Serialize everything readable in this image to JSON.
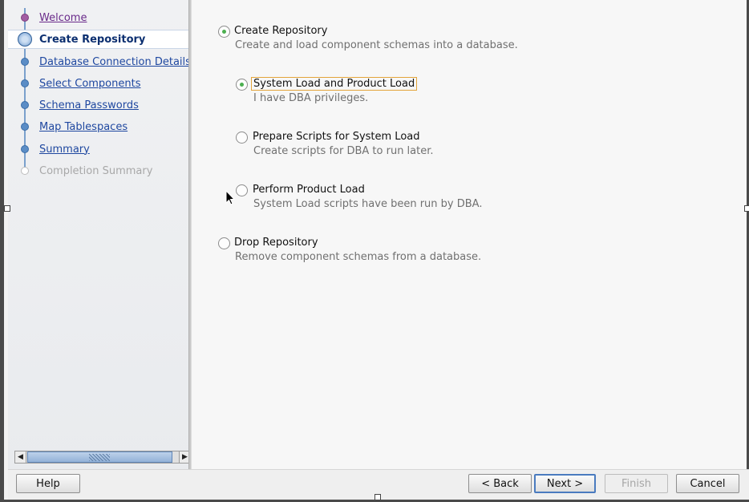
{
  "sidebar": {
    "items": [
      {
        "label": "Welcome",
        "state": "visited"
      },
      {
        "label": "Create Repository",
        "state": "current"
      },
      {
        "label": "Database Connection Details",
        "state": "link"
      },
      {
        "label": "Select Components",
        "state": "link"
      },
      {
        "label": "Schema Passwords",
        "state": "link"
      },
      {
        "label": "Map Tablespaces",
        "state": "link"
      },
      {
        "label": "Summary",
        "state": "link"
      },
      {
        "label": "Completion Summary",
        "state": "pending"
      }
    ]
  },
  "options": {
    "create_repository": {
      "label": "Create Repository",
      "description": "Create and load component schemas into a database.",
      "selected": true
    },
    "system_load_product_load": {
      "label": "System Load and Product Load",
      "description": "I have DBA privileges.",
      "selected": true
    },
    "prepare_scripts": {
      "label": "Prepare Scripts for System Load",
      "description": "Create scripts for DBA to run later.",
      "selected": false
    },
    "perform_product_load": {
      "label": "Perform Product Load",
      "description": "System Load scripts have been run by DBA.",
      "selected": false
    },
    "drop_repository": {
      "label": "Drop Repository",
      "description": "Remove component schemas from a database.",
      "selected": false
    }
  },
  "buttons": {
    "help": "Help",
    "back": "< Back",
    "next": "Next >",
    "finish": "Finish",
    "cancel": "Cancel"
  },
  "colors": {
    "radio_selected": "#4caf50",
    "link": "#1f48a0",
    "focus_border": "#e3a43a"
  }
}
